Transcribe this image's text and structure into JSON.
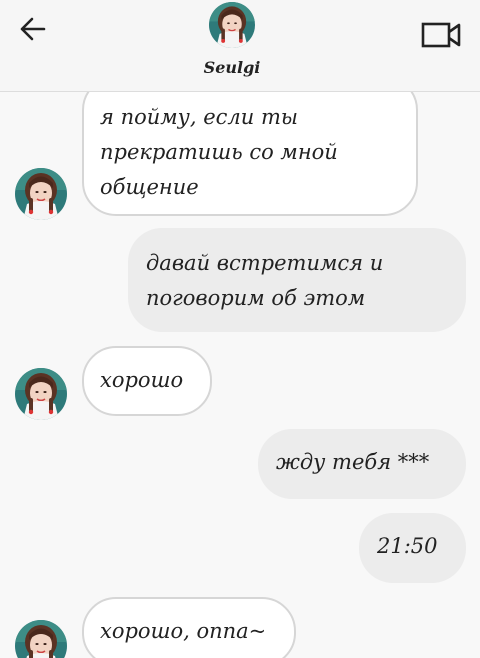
{
  "header": {
    "contact_name": "Seulgi",
    "back_icon": "arrow-left-icon",
    "video_icon": "video-camera-icon"
  },
  "messages": [
    {
      "direction": "in",
      "text": "я пойму, если ты\nпрекратишь со мной\nобщение"
    },
    {
      "direction": "out",
      "text": "давай встретимся и\nпоговорим об этом"
    },
    {
      "direction": "in",
      "text": "хорошо"
    },
    {
      "direction": "out",
      "text": "жду тебя ***"
    },
    {
      "direction": "out",
      "text": "21:50"
    },
    {
      "direction": "in",
      "text": "хорошо, оппа~"
    }
  ],
  "colors": {
    "background": "#f8f8f8",
    "incoming_bubble": "#ffffff",
    "incoming_border": "#d6d6d6",
    "outgoing_bubble": "#ececec"
  }
}
